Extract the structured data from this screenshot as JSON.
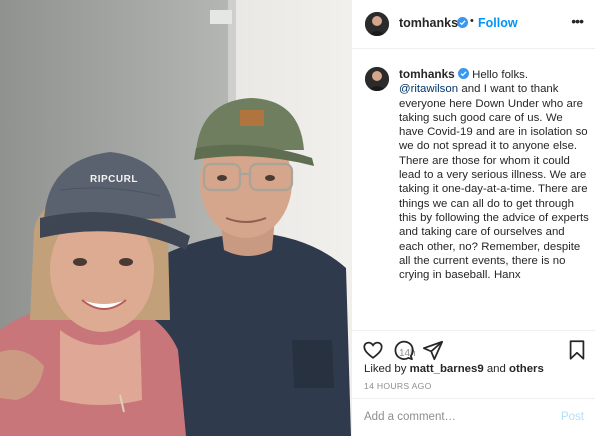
{
  "header": {
    "username": "tomhanks",
    "separator": "•",
    "follow_label": "Follow",
    "more_icon": "more-options-icon"
  },
  "post": {
    "photo_caps": {
      "left_cap_logo": "RIPCURL"
    },
    "caption": {
      "username": "tomhanks",
      "text_intro": "Hello folks. ",
      "mention": "@ritawilson",
      "text_body": " and I want to thank everyone here Down Under who are taking such good care of us. We have Covid-19 and are in isolation so we do not spread it to anyone else. There are those for whom it could lead to a very serious illness. We are taking it one-day-at-a-time. There are things we can all do to get through this by following the advice of experts and taking care of ourselves and each other, no? Remember, despite all the current events, there is no crying in baseball. Hanx"
    },
    "caption_time": "14h"
  },
  "actions": {
    "like_icon": "heart-icon",
    "comment_icon": "comment-icon",
    "share_icon": "share-icon",
    "save_icon": "bookmark-icon",
    "likes_prefix": "Liked by ",
    "liked_by_user": "matt_barnes9",
    "likes_suffix_and": " and ",
    "likes_others": "others",
    "posted_time": "14 HOURS AGO"
  },
  "comment": {
    "placeholder": "Add a comment…",
    "post_label": "Post"
  },
  "colors": {
    "link_blue": "#0095f6",
    "verified_blue": "#3897f0",
    "mention_blue": "#00376b",
    "muted": "#8e8e8e",
    "post_disabled": "#b2dffc"
  }
}
